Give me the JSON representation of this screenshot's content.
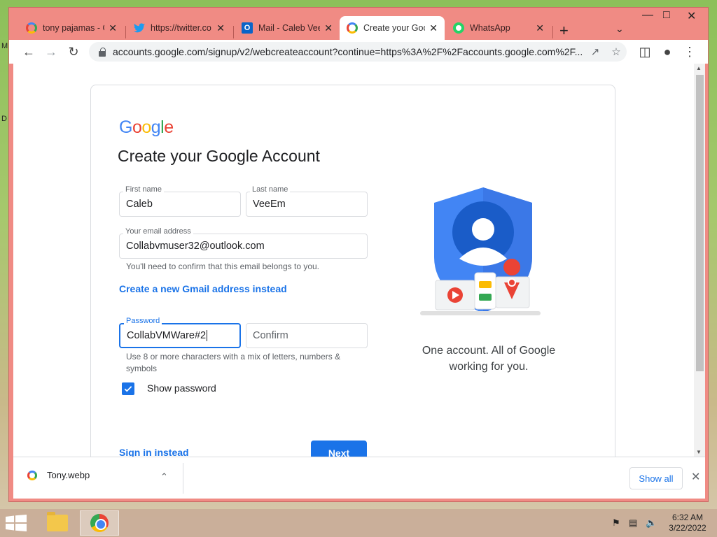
{
  "browser": {
    "tabs": [
      {
        "title": "tony pajamas - G",
        "icon": "google-icon",
        "active": false
      },
      {
        "title": "https://twitter.co",
        "icon": "twitter-icon",
        "active": false
      },
      {
        "title": "Mail - Caleb Vee",
        "icon": "outlook-icon",
        "active": false
      },
      {
        "title": "Create your Goo",
        "icon": "google-icon",
        "active": true
      },
      {
        "title": "WhatsApp",
        "icon": "whatsapp-icon",
        "active": false
      }
    ],
    "url": "accounts.google.com/signup/v2/webcreateaccount?continue=https%3A%2F%2Faccounts.google.com%2F..."
  },
  "form": {
    "logo": "Google",
    "title": "Create your Google Account",
    "first_name_label": "First name",
    "first_name_value": "Caleb",
    "last_name_label": "Last name",
    "last_name_value": "VeeEm",
    "email_label": "Your email address",
    "email_value": "Collabvmuser32@outlook.com",
    "email_hint": "You'll need to confirm that this email belongs to you.",
    "gmail_link": "Create a new Gmail address instead",
    "password_label": "Password",
    "password_value": "CollabVMWare#2",
    "confirm_placeholder": "Confirm",
    "password_hint": "Use 8 or more characters with a mix of letters, numbers & symbols",
    "show_password_label": "Show password",
    "show_password_checked": true,
    "sign_in_link": "Sign in instead",
    "next_button": "Next",
    "tagline": "One account. All of Google working for you."
  },
  "downloads": {
    "file_name": "Tony.webp",
    "show_all": "Show all"
  },
  "taskbar": {
    "time": "6:32 AM",
    "date": "3/22/2022"
  },
  "colors": {
    "accent": "#1a73e8",
    "window_frame": "#f08b84"
  }
}
